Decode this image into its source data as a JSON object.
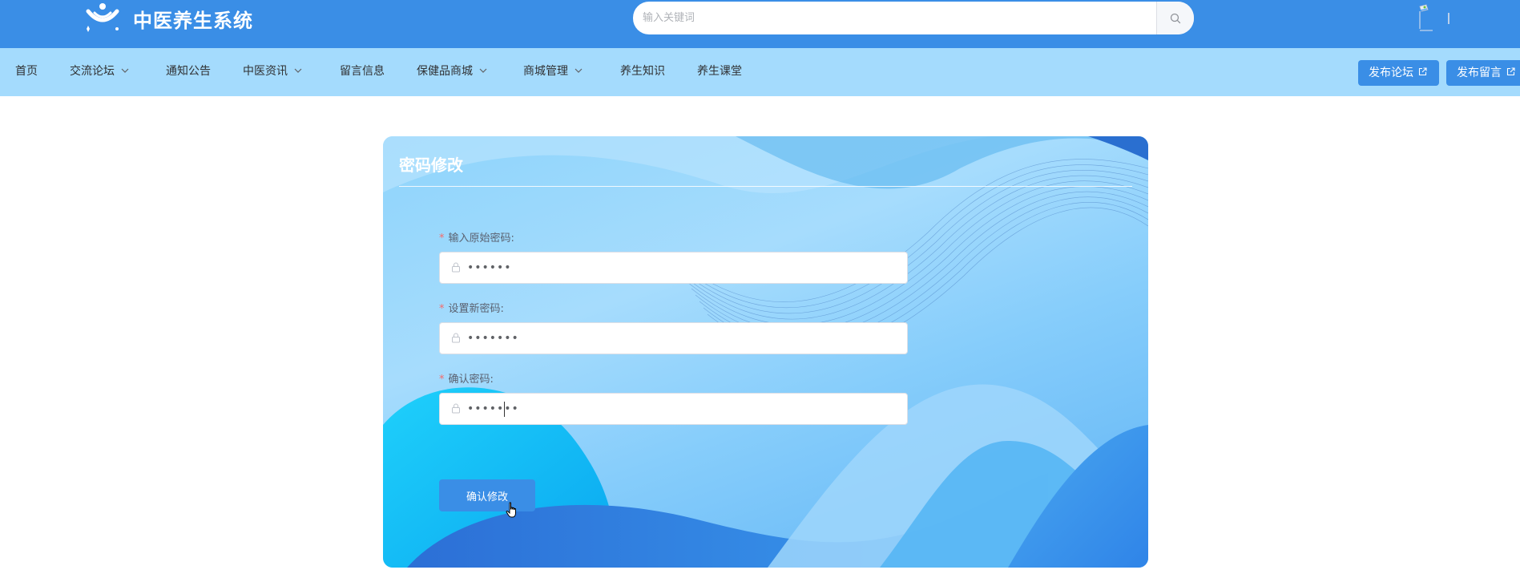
{
  "header": {
    "site_title": "中医养生系统",
    "search_placeholder": "输入关键词",
    "search_icon": "search-icon",
    "avatar_icon": "user-avatar-icon"
  },
  "nav": {
    "items": [
      {
        "label": "首页",
        "has_dropdown": false
      },
      {
        "label": "交流论坛",
        "has_dropdown": true
      },
      {
        "label": "通知公告",
        "has_dropdown": false
      },
      {
        "label": "中医资讯",
        "has_dropdown": true
      },
      {
        "label": "留言信息",
        "has_dropdown": false
      },
      {
        "label": "保健品商城",
        "has_dropdown": true
      },
      {
        "label": "商城管理",
        "has_dropdown": true
      },
      {
        "label": "养生知识",
        "has_dropdown": false
      },
      {
        "label": "养生课堂",
        "has_dropdown": false
      }
    ],
    "buttons": [
      {
        "label": "发布论坛",
        "icon": "external-link-icon"
      },
      {
        "label": "发布留言",
        "icon": "external-link-icon"
      }
    ]
  },
  "form": {
    "title": "密码修改",
    "required_mark": "*",
    "fields": [
      {
        "label": "输入原始密码:",
        "value": "••••••",
        "icon": "lock-icon"
      },
      {
        "label": "设置新密码:",
        "value": "•••••••",
        "icon": "lock-icon"
      },
      {
        "label": "确认密码:",
        "value": "•••••••",
        "icon": "lock-icon"
      }
    ],
    "submit_label": "确认修改"
  },
  "colors": {
    "header_bg": "#3a8ee6",
    "nav_bg": "#a4dbfd",
    "primary": "#3a8ee6",
    "required": "#f56c6c"
  }
}
